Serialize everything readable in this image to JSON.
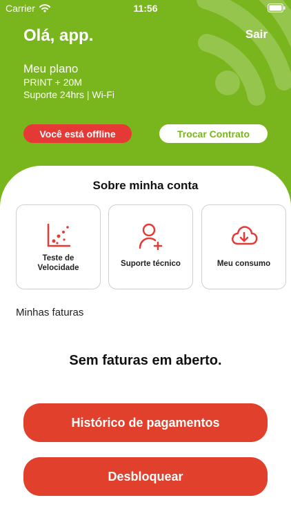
{
  "status_bar": {
    "carrier": "Carrier",
    "time": "11:56"
  },
  "header": {
    "greeting": "Olá, app.",
    "logout_label": "Sair"
  },
  "plan": {
    "title": "Meu plano",
    "name": "PRINT + 20M",
    "details": "Suporte 24hrs | Wi-Fi"
  },
  "badges": {
    "offline": "Você está offline",
    "change_contract": "Trocar Contrato"
  },
  "account": {
    "title": "Sobre minha conta",
    "cards": [
      {
        "label": "Teste de Velocidade",
        "icon": "speed-chart-icon"
      },
      {
        "label": "Suporte técnico",
        "icon": "user-add-icon"
      },
      {
        "label": "Meu consumo",
        "icon": "cloud-download-icon"
      }
    ]
  },
  "invoices": {
    "label": "Minhas faturas",
    "empty_message": "Sem faturas em aberto."
  },
  "actions": {
    "history": "Histórico de pagamentos",
    "unlock": "Desbloquear"
  },
  "colors": {
    "brand_green": "#79b51d",
    "accent_red": "#e0402c",
    "offline_red": "#e53935"
  }
}
